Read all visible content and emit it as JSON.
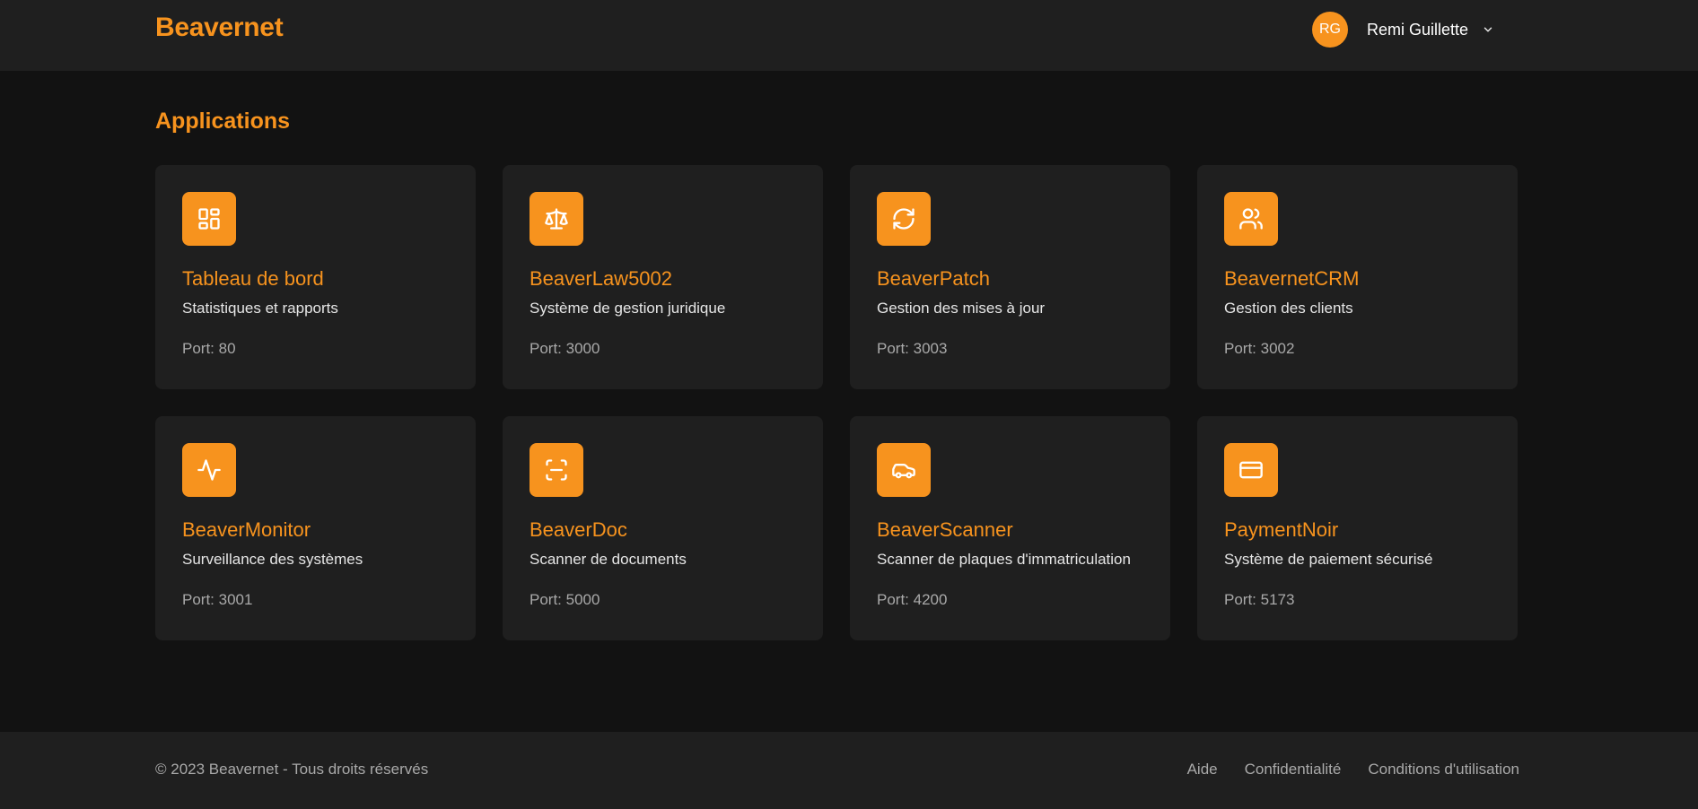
{
  "header": {
    "brand": "Beavernet",
    "user": {
      "initials": "RG",
      "name": "Remi Guillette"
    }
  },
  "main": {
    "title": "Applications",
    "apps": [
      {
        "name": "Tableau de bord",
        "description": "Statistiques et rapports",
        "port": "Port: 80",
        "icon": "dashboard-icon"
      },
      {
        "name": "BeaverLaw5002",
        "description": "Système de gestion juridique",
        "port": "Port: 3000",
        "icon": "scale-icon"
      },
      {
        "name": "BeaverPatch",
        "description": "Gestion des mises à jour",
        "port": "Port: 3003",
        "icon": "refresh-icon"
      },
      {
        "name": "BeavernetCRM",
        "description": "Gestion des clients",
        "port": "Port: 3002",
        "icon": "users-icon"
      },
      {
        "name": "BeaverMonitor",
        "description": "Surveillance des systèmes",
        "port": "Port: 3001",
        "icon": "activity-icon"
      },
      {
        "name": "BeaverDoc",
        "description": "Scanner de documents",
        "port": "Port: 5000",
        "icon": "scan-icon"
      },
      {
        "name": "BeaverScanner",
        "description": "Scanner de plaques d'immatriculation",
        "port": "Port: 4200",
        "icon": "car-icon"
      },
      {
        "name": "PaymentNoir",
        "description": "Système de paiement sécurisé",
        "port": "Port: 5173",
        "icon": "credit-card-icon"
      }
    ]
  },
  "footer": {
    "copyright": "© 2023 Beavernet - Tous droits réservés",
    "links": [
      "Aide",
      "Confidentialité",
      "Conditions d'utilisation"
    ]
  },
  "colors": {
    "accent": "#f7931e",
    "background": "#121212",
    "surface": "#1f1f1f"
  }
}
